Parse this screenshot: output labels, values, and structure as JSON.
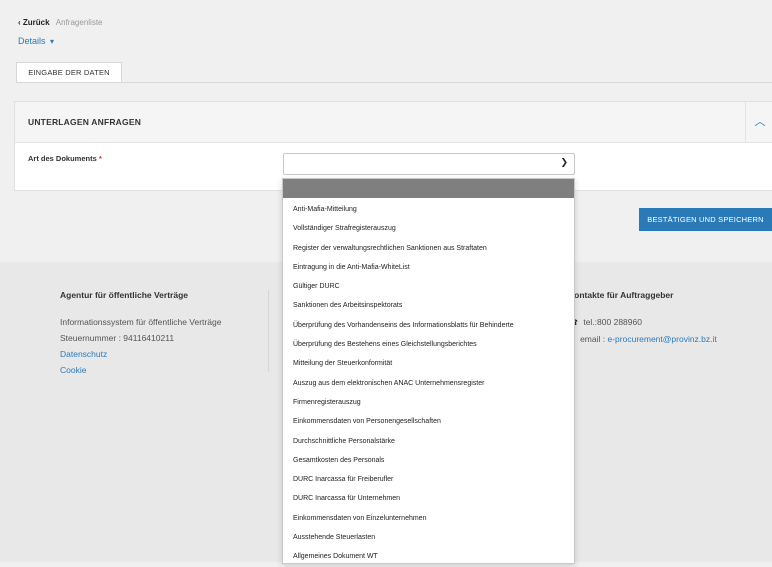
{
  "breadcrumb": {
    "back": "‹ Zurück",
    "current": "Anfragenliste"
  },
  "details": {
    "label": "Details",
    "icon": "chevron-down-icon"
  },
  "tabs": [
    {
      "label": "EINGABE DER DATEN"
    }
  ],
  "panel": {
    "title": "UNTERLAGEN ANFRAGEN",
    "collapse_icon": "chevron-up-icon",
    "field_label": "Art des Dokuments",
    "required_mark": "*",
    "selected_value": ""
  },
  "actions": {
    "confirm_label": "BESTÄTIGEN UND SPEICHERN"
  },
  "dropdown": {
    "options": [
      "Anti-Mafia-Mitteilung",
      "Vollständiger Strafregisterauszug",
      "Register der verwaltungsrechtlichen Sanktionen aus Straftaten",
      "Eintragung in die Anti-Mafia-WhiteList",
      "Gültiger DURC",
      "Sanktionen des Arbeitsinspektorats",
      "Überprüfung des Vorhandenseins des Informationsblatts für Behinderte",
      "Überprüfung des Bestehens eines Gleichstellungsberichtes",
      "Mitteilung der Steuerkonformität",
      "Auszug aus dem elektronischen ANAC Unternehmensregister",
      "Firmenregisterauszug",
      "Einkommensdaten von Personengesellschaften",
      "Durchschnittliche Personalstärke",
      "Gesamtkosten des Personals",
      "DURC Inarcassa für Freiberufler",
      "DURC Inarcassa für Unternehmen",
      "Einkommensdaten von Einzelunternehmen",
      "Ausstehende Steuerlasten",
      "Allgemeines Dokument WT"
    ]
  },
  "footer": {
    "agency": {
      "title": "Agentur für öffentliche Verträge",
      "system": "Informationssystem für öffentliche Verträge",
      "tax_number": "Steuernummer : 94116410211",
      "privacy_link": "Datenschutz",
      "cookie_link": "Cookie"
    },
    "contacts": {
      "title": "Kontakte für Auftraggeber",
      "phone": "tel.:800 288960",
      "email_prefix": "email :",
      "email": "e-procurement@provinz.bz.it",
      "phone_icon": "phone-icon",
      "email_icon": "envelope-icon"
    }
  },
  "colors": {
    "accent": "#2a7ab8",
    "required": "#c0392b",
    "selected_option_bg": "#7f7f7f"
  }
}
